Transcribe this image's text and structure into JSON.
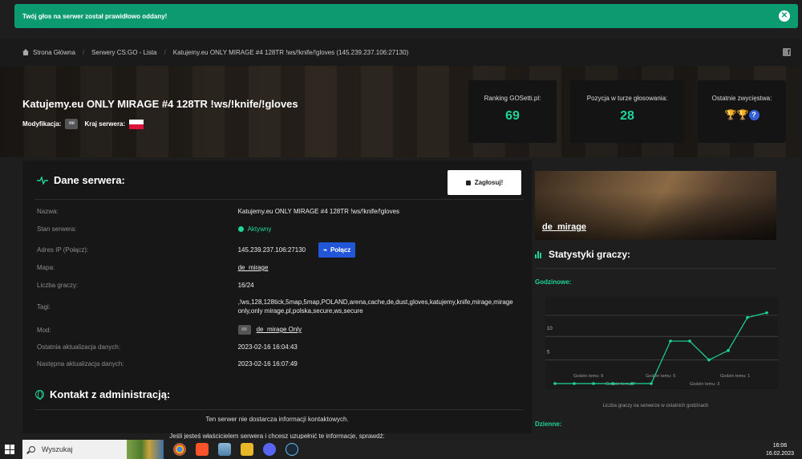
{
  "notification": {
    "text": "Twój głos na serwer został prawidłowo oddany!"
  },
  "breadcrumb": [
    "Strona Główna",
    "Serwery CS:GO - Lista",
    "Katujemy.eu ONLY MIRAGE #4 128TR !ws/!knife/!gloves (145.239.237.106:27130)"
  ],
  "hero": {
    "title": "Katujemy.eu ONLY MIRAGE #4 128TR !ws/!knife/!gloves",
    "mod_label": "Modyfikacja:",
    "mod_badge": "mi",
    "country_label": "Kraj serwera:",
    "cards": [
      {
        "label": "Ranking GOSetti.pl:",
        "value": "69"
      },
      {
        "label": "Pozycja w turze głosowania:",
        "value": "28"
      },
      {
        "label": "Ostatnie zwycięstwa:",
        "icons": [
          "gold-trophy-icon",
          "silver-trophy-icon",
          "question-icon"
        ]
      }
    ]
  },
  "server_data": {
    "heading": "Dane serwera:",
    "vote_button": "Zagłosuj!",
    "rows": [
      {
        "label": "Nazwa:",
        "value": "Katujemy.eu ONLY MIRAGE #4 128TR !ws/!knife/!gloves"
      },
      {
        "label": "Stan serwera:",
        "value": "Aktywny"
      },
      {
        "label": "Adres IP (Połącz):",
        "value": "145.239.237.106:27130",
        "button": "Połącz"
      },
      {
        "label": "Mapa:",
        "value": "de_mirage"
      },
      {
        "label": "Liczba graczy:",
        "value": "16/24"
      },
      {
        "label": "Tagi:",
        "value": ",!ws,128,128tick,5map,5map,POLAND,arena,cache,de,dust,gloves,katujemy,knife,mirage,mirage only,only mirage,pl,polska,secure,ws,secure"
      },
      {
        "label": "Mod:",
        "badge": "mi",
        "value": "de_mirage Only"
      },
      {
        "label": "Ostatnia aktualizacja danych:",
        "value": "2023-02-16 16:04:43"
      },
      {
        "label": "Następna aktualizacja danych:",
        "value": "2023-02-16 16:07:49"
      }
    ]
  },
  "contact": {
    "heading": "Kontakt z administracją:",
    "line1": "Ten serwer nie dostarcza informacji kontaktowych.",
    "line2": "Jeśli jesteś właścicielem serwera i chcesz uzupełnić te informacje, sprawdź:"
  },
  "map_card": {
    "name": "de_mirage"
  },
  "stats": {
    "heading": "Statystyki graczy:",
    "hourly_label": "Godzinowe:",
    "daily_label": "Dzienne:",
    "caption": "Liczba graczy na serwerze w ostatnich godzinach"
  },
  "chart_data": {
    "type": "line",
    "title": "",
    "ylabel": "",
    "xlabel": "Liczba graczy na serwerze w ostatnich godzinach",
    "yticks": [
      "5",
      "10"
    ],
    "xtick_labels": [
      "Godzin temu: 9",
      "Godzin temu: 7",
      "Godzin temu: 5",
      "Godzin temu: 3",
      "Godzin temu: 1"
    ],
    "ylim": [
      0,
      17
    ],
    "series": [
      {
        "values": [
          0,
          0,
          0,
          0,
          0,
          0,
          9,
          9,
          5,
          7,
          14,
          15
        ]
      }
    ],
    "color": "#1fd49a"
  },
  "taskbar": {
    "search_placeholder": "Wyszukaj",
    "time": "16:06",
    "date": "16.02.2023"
  }
}
